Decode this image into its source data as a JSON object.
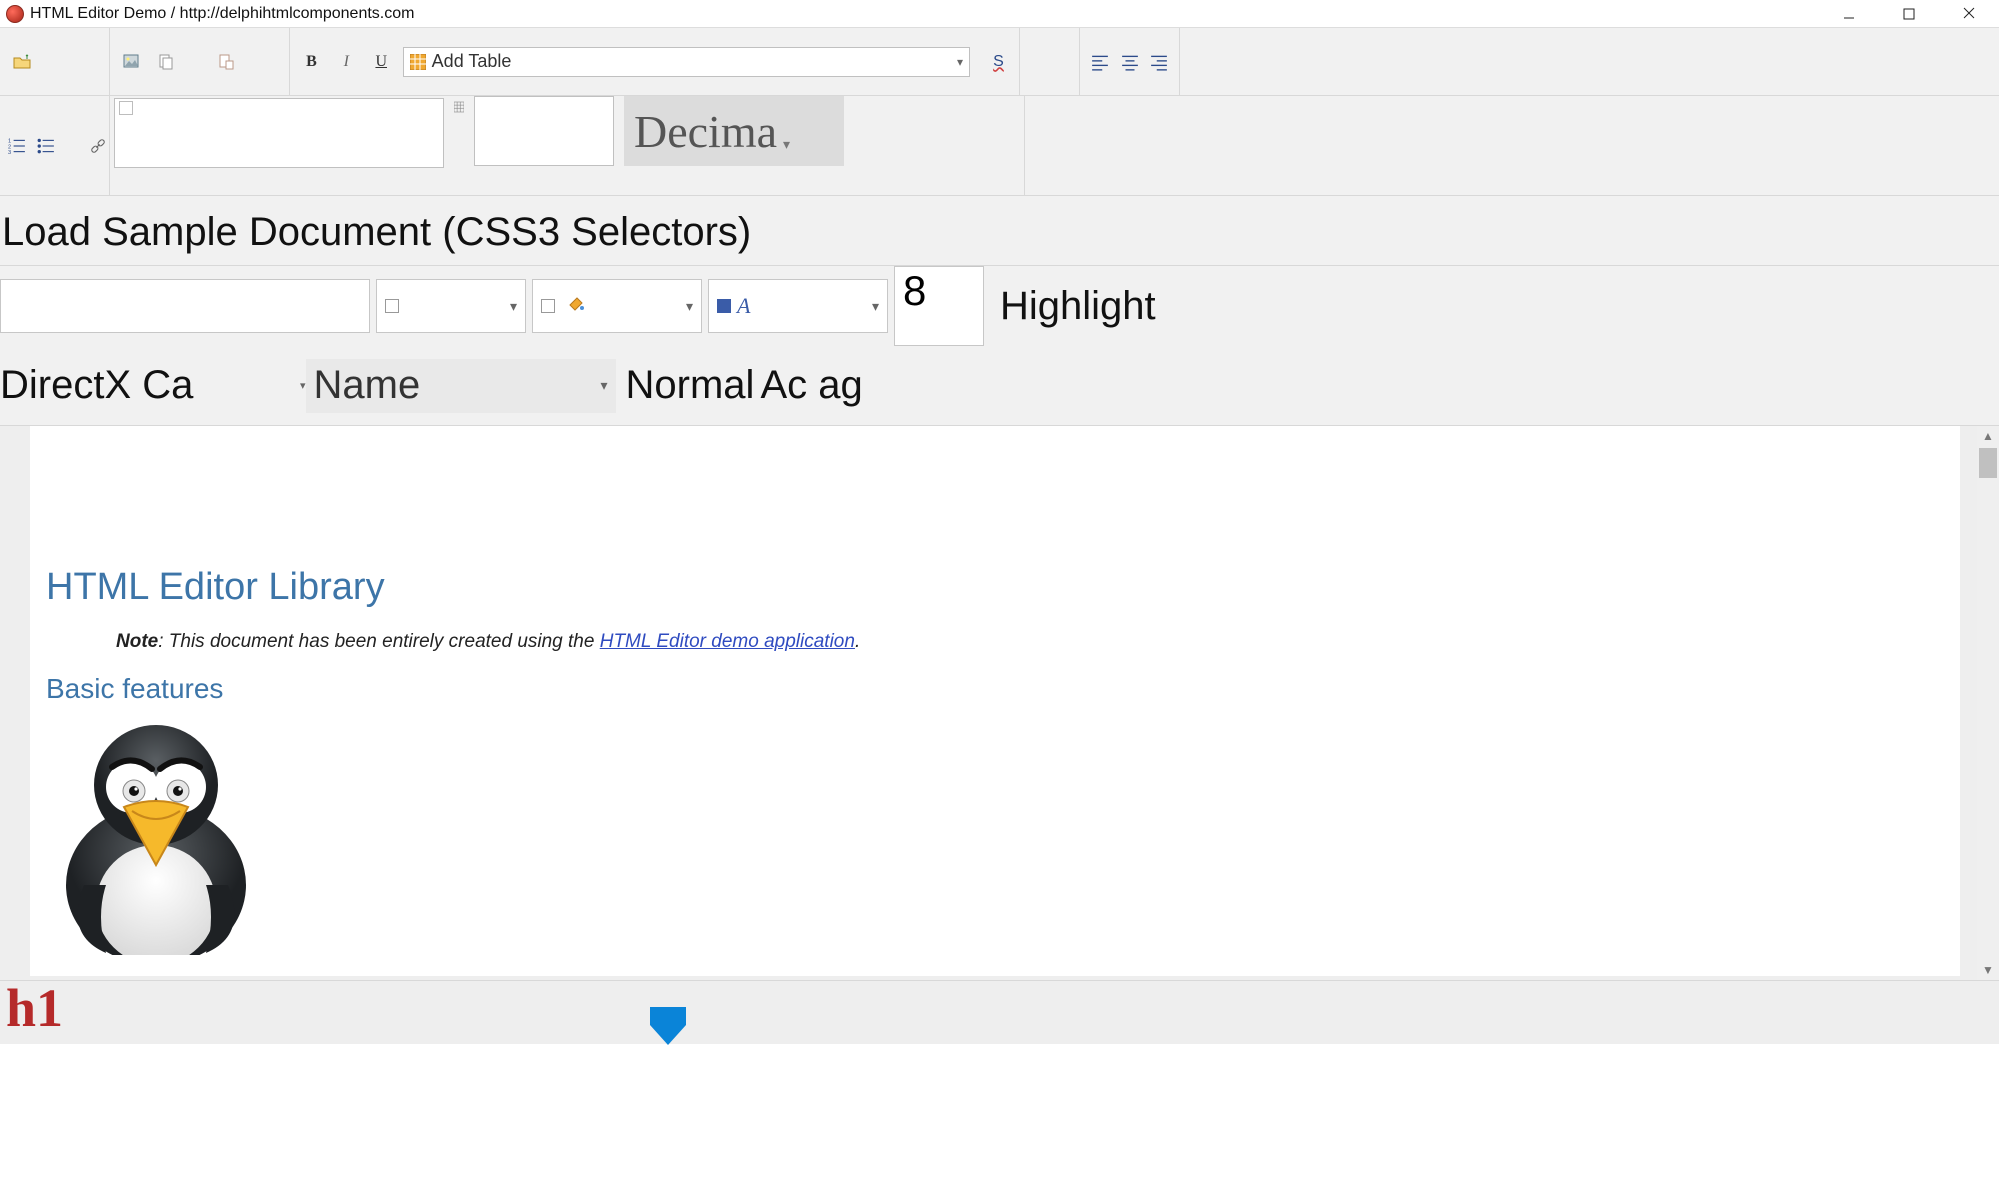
{
  "window": {
    "title": "HTML Editor Demo / http://delphihtmlcomponents.com"
  },
  "toolbar1": {
    "open_icon": "open-folder-icon",
    "img_icons": [
      "image-icon",
      "copy-icon",
      "paste-icon"
    ],
    "bold": "B",
    "italic": "I",
    "underline": "U",
    "add_table_label": "Add Table",
    "spellcheck_label": "S"
  },
  "toolbar2": {
    "font_name": "Decima",
    "style_swatch": ""
  },
  "controls": {
    "load_button_label": "Load Sample Document (CSS3 Selectors)",
    "zoom_value": "8",
    "highlight_label": "Highlight",
    "canvas_label": "DirectX Canvas",
    "name_drop": "Name",
    "normal_drop": "Normal",
    "action_label": "Add Tag",
    "action_visible": "Ac     ag"
  },
  "document": {
    "heading": "HTML Editor Library",
    "note_label": "Note",
    "note_text": ": This document has been entirely created using the ",
    "note_link": "HTML Editor demo application",
    "note_tail": ".",
    "section1": "Basic features"
  },
  "status": {
    "current_tag": "h1"
  }
}
